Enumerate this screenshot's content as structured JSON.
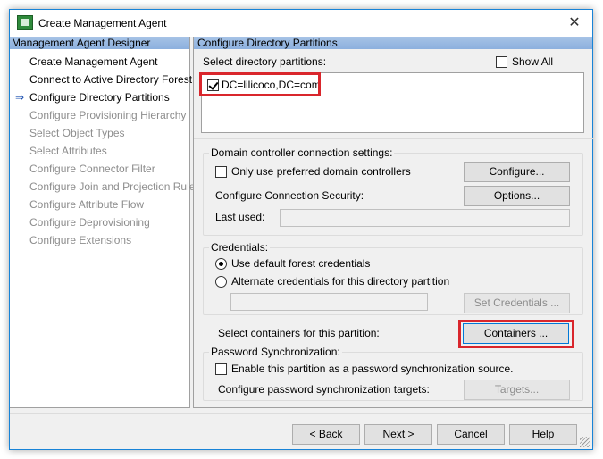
{
  "window": {
    "title": "Create Management Agent"
  },
  "designer": {
    "header": "Management Agent Designer",
    "steps": [
      {
        "label": "Create Management Agent",
        "state": "done"
      },
      {
        "label": "Connect to Active Directory Forest",
        "state": "done"
      },
      {
        "label": "Configure Directory Partitions",
        "state": "current"
      },
      {
        "label": "Configure Provisioning Hierarchy",
        "state": "disabled"
      },
      {
        "label": "Select Object Types",
        "state": "disabled"
      },
      {
        "label": "Select Attributes",
        "state": "disabled"
      },
      {
        "label": "Configure Connector Filter",
        "state": "disabled"
      },
      {
        "label": "Configure Join and Projection Rules",
        "state": "disabled"
      },
      {
        "label": "Configure Attribute Flow",
        "state": "disabled"
      },
      {
        "label": "Configure Deprovisioning",
        "state": "disabled"
      },
      {
        "label": "Configure Extensions",
        "state": "disabled"
      }
    ]
  },
  "page": {
    "header": "Configure Directory Partitions",
    "select_label": "Select directory partitions:",
    "show_all_label": "Show All",
    "show_all_checked": false,
    "partitions": [
      {
        "label": "DC=lilicoco,DC=com",
        "checked": true
      }
    ],
    "dc_group": {
      "title": "Domain controller connection settings:",
      "preferred_label": "Only use preferred domain controllers",
      "preferred_checked": false,
      "configure_button": "Configure...",
      "security_label": "Configure Connection Security:",
      "options_button": "Options...",
      "last_used_label": "Last used:",
      "last_used_value": ""
    },
    "credentials": {
      "title": "Credentials:",
      "default_label": "Use default forest credentials",
      "alternate_label": "Alternate credentials for this directory partition",
      "selected": "default",
      "alternate_value": "",
      "set_button": "Set Credentials ..."
    },
    "containers": {
      "label": "Select containers for this partition:",
      "button": "Containers ..."
    },
    "password_sync": {
      "title": "Password Synchronization:",
      "enable_label": "Enable this partition as a password synchronization source.",
      "enable_checked": false,
      "targets_label": "Configure password synchronization targets:",
      "targets_button": "Targets..."
    }
  },
  "footer": {
    "back": "< Back",
    "next": "Next >",
    "cancel": "Cancel",
    "help": "Help"
  },
  "colors": {
    "highlight": "#d9262c",
    "header_blue": "#a7c3e6",
    "accent": "#0078d7"
  }
}
